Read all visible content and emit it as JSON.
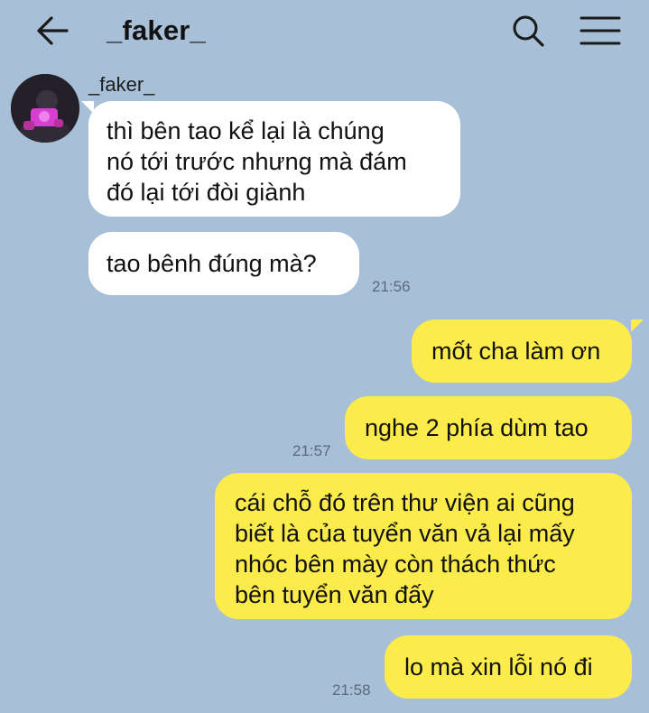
{
  "header": {
    "title": "_faker_",
    "back_icon": "arrow-left-icon",
    "search_icon": "search-icon",
    "menu_icon": "hamburger-menu-icon"
  },
  "colors": {
    "background": "#a7bfd7",
    "incoming_bubble": "#ffffff",
    "outgoing_bubble": "#fbeb4b"
  },
  "conversation": {
    "contact_name": "_faker_",
    "messages": [
      {
        "direction": "in",
        "text": "thì bên tao kể lại là chúng\nnó tới trước nhưng mà đám\nđó lại tới đòi giành",
        "time": ""
      },
      {
        "direction": "in",
        "text": "tao bênh đúng mà?",
        "time": "21:56"
      },
      {
        "direction": "out",
        "text": "mốt cha làm ơn",
        "time": ""
      },
      {
        "direction": "out",
        "text": "nghe 2 phía dùm tao",
        "time": "21:57"
      },
      {
        "direction": "out",
        "text": "cái chỗ đó trên thư viện ai cũng\nbiết là của tuyển văn vả lại mấy\nnhóc bên mày còn thách thức\nbên tuyển văn đấy",
        "time": ""
      },
      {
        "direction": "out",
        "text": "lo mà xin lỗi nó đi",
        "time": "21:58"
      }
    ]
  }
}
